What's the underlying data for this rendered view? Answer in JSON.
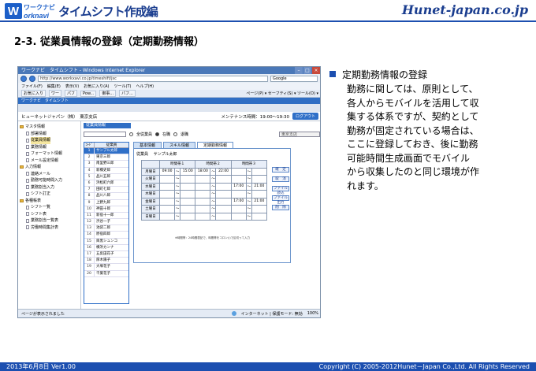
{
  "slide": {
    "logo_small_top": "ワークナビ",
    "logo_small_bottom": "orknavi",
    "logo_letter": "W",
    "logo_title": "タイムシフト作成編",
    "brand": "Hunet-japan.co.jp",
    "heading": "2-3. 従業員情報の登録（定期勤務情報）",
    "footer_left": "2013年6月8日 Ver1.00",
    "footer_right": "Copyright (C) 2005-2012Hunet－Japan Co.,Ltd. All Rights Reserved",
    "bullet_title": "定期勤務情報の登録",
    "bullet_text": "勤務に関しては、原則として、\n各人からモバイルを活用して収\n集する体系ですが、契約として\n勤務が固定されている場合は、\nここに登録しておき、後に勤務\n可能時間生成画面でモバイル\nから収集したのと同じ環境が作\nれます。"
  },
  "browser": {
    "title": "ワークナビ　タイムシフト - Windows Internet Explorer",
    "url": "http://www.workxavi.co.jp/timeshift/jsc",
    "search_placeholder": "Google",
    "menu": [
      "ファイル(F)",
      "編集(E)",
      "表示(V)",
      "お気に入り(A)",
      "ツール(T)",
      "ヘルプ(H)"
    ],
    "fav_label": "お気に入り",
    "fav_items": [
      "ワー",
      "パフ",
      "Pow...",
      "御事...",
      "パフ..."
    ],
    "fav_right": "ページ(P) ▾  セーフティ(S) ▾  ツール(O) ▾",
    "app_header": "ワークナビ　タイムシフト",
    "status_left": "ページが表示されました",
    "status_zone": "インターネット | 保護モード: 無効",
    "zoom": "100%"
  },
  "app": {
    "company": "ヒューネットジャパン（株）　東京支店",
    "maint_time": "メンテナンス時間：19:00～19:30",
    "logout": "ログアウト",
    "sidebar": [
      {
        "label": "マスタ情報",
        "level": 1,
        "type": "folder"
      },
      {
        "label": "部署情報",
        "level": 2,
        "type": "doc"
      },
      {
        "label": "従業員情報",
        "level": 2,
        "type": "doc",
        "selected": true
      },
      {
        "label": "業務情報",
        "level": 2,
        "type": "doc"
      },
      {
        "label": "フォーマット情報",
        "level": 2,
        "type": "doc"
      },
      {
        "label": "メール設定情報",
        "level": 2,
        "type": "doc"
      },
      {
        "label": "入力情報",
        "level": 1,
        "type": "folder"
      },
      {
        "label": "連絡メール",
        "level": 2,
        "type": "doc"
      },
      {
        "label": "勤務可能時間入力",
        "level": 2,
        "type": "doc"
      },
      {
        "label": "業務割当入力",
        "level": 2,
        "type": "doc"
      },
      {
        "label": "シフト訂正",
        "level": 2,
        "type": "doc"
      },
      {
        "label": "各種帳表",
        "level": 1,
        "type": "folder"
      },
      {
        "label": "シフト一覧",
        "level": 2,
        "type": "doc"
      },
      {
        "label": "シフト表",
        "level": 2,
        "type": "doc"
      },
      {
        "label": "業務割当一覧表",
        "level": 2,
        "type": "doc"
      },
      {
        "label": "労働時間集計表",
        "level": 2,
        "type": "doc"
      }
    ],
    "panel_title": "従業員情報",
    "filter_radios": [
      "全従業員",
      "在職",
      "退職"
    ],
    "branch_select": "東京支店",
    "list_headers": [
      "ｺｰﾄﾞ",
      "従業員"
    ],
    "employees": [
      {
        "code": "1",
        "name": "サンプル太郎",
        "selected": true
      },
      {
        "code": "2",
        "name": "東京三郎"
      },
      {
        "code": "3",
        "name": "南里野三郎"
      },
      {
        "code": "4",
        "name": "新橋史郎"
      },
      {
        "code": "5",
        "name": "品川五郎"
      },
      {
        "code": "6",
        "name": "浜松町六郎"
      },
      {
        "code": "7",
        "name": "田町七郎"
      },
      {
        "code": "8",
        "name": "品川八郎"
      },
      {
        "code": "9",
        "name": "上野九郎"
      },
      {
        "code": "10",
        "name": "神田十郎"
      },
      {
        "code": "11",
        "name": "新宿十一郎"
      },
      {
        "code": "12",
        "name": "渋谷一子"
      },
      {
        "code": "13",
        "name": "池袋二郎"
      },
      {
        "code": "14",
        "name": "原宿四郎"
      },
      {
        "code": "15",
        "name": "目黒シュンコ"
      },
      {
        "code": "16",
        "name": "横浜カンナ"
      },
      {
        "code": "17",
        "name": "五反田花子"
      },
      {
        "code": "18",
        "name": "厚木陽子"
      },
      {
        "code": "19",
        "name": "大塚花子"
      },
      {
        "code": "20",
        "name": "千葉花子"
      }
    ],
    "tabs": [
      "基本情報",
      "スキル情報",
      "定期勤務情報"
    ],
    "detail": {
      "employee_label": "従業員",
      "employee_name": "サンプル太郎",
      "headers": [
        "時間帯１",
        "時間帯２",
        "時間帯３"
      ],
      "rows": [
        {
          "day": "月曜日",
          "s1": "09:00",
          "e1": "15:00",
          "s2": "18:00",
          "e2": "22:00",
          "s3": "",
          "e3": ""
        },
        {
          "day": "火曜日",
          "s1": "",
          "e1": "",
          "s2": "",
          "e2": "",
          "s3": "",
          "e3": ""
        },
        {
          "day": "水曜日",
          "s1": "",
          "e1": "",
          "s2": "",
          "e2": "",
          "s3": "17:00",
          "e3": "21:00"
        },
        {
          "day": "木曜日",
          "s1": "",
          "e1": "",
          "s2": "",
          "e2": "",
          "s3": "",
          "e3": ""
        },
        {
          "day": "金曜日",
          "s1": "",
          "e1": "",
          "s2": "",
          "e2": "",
          "s3": "17:00",
          "e3": "21:00"
        },
        {
          "day": "土曜日",
          "s1": "",
          "e1": "",
          "s2": "",
          "e2": "",
          "s3": "",
          "e3": ""
        },
        {
          "day": "日曜日",
          "s1": "",
          "e1": "",
          "s2": "",
          "e2": "",
          "s3": "",
          "e3": ""
        }
      ],
      "sep": "～",
      "note": "※時間帯：24時間表記で、時間帯をコロン(:)で区切って入力"
    },
    "actions": [
      "確　定",
      "取　消",
      "ファイル読込",
      "ファイル出力",
      "削　除"
    ]
  }
}
